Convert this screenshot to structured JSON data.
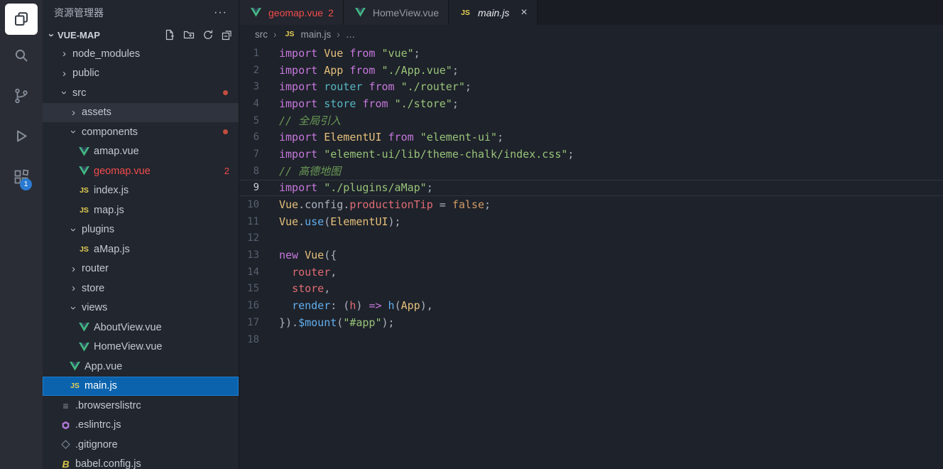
{
  "activity_bar": {
    "items": [
      {
        "name": "explorer",
        "active": true
      },
      {
        "name": "search"
      },
      {
        "name": "source-control"
      },
      {
        "name": "run-and-debug"
      },
      {
        "name": "extensions",
        "badge": "1"
      }
    ]
  },
  "sidebar": {
    "title": "资源管理器",
    "title_more": "···",
    "section": {
      "label": "VUE-MAP",
      "actions": [
        "new-file",
        "new-folder",
        "refresh-explorer",
        "collapse-folders"
      ]
    },
    "tree": [
      {
        "label": "node_modules",
        "depth": 0,
        "arrow": "collapsed"
      },
      {
        "label": "public",
        "depth": 0,
        "arrow": "collapsed"
      },
      {
        "label": "src",
        "depth": 0,
        "arrow": "expanded",
        "dot": true
      },
      {
        "label": "assets",
        "depth": 1,
        "arrow": "collapsed",
        "state": "hover"
      },
      {
        "label": "components",
        "depth": 1,
        "arrow": "expanded",
        "dot": true
      },
      {
        "label": "amap.vue",
        "depth": 2,
        "icon": "vue"
      },
      {
        "label": "geomap.vue",
        "depth": 2,
        "icon": "vue",
        "error": true,
        "badge": "2"
      },
      {
        "label": "index.js",
        "depth": 2,
        "icon": "js"
      },
      {
        "label": "map.js",
        "depth": 2,
        "icon": "js"
      },
      {
        "label": "plugins",
        "depth": 1,
        "arrow": "expanded"
      },
      {
        "label": "aMap.js",
        "depth": 2,
        "icon": "js"
      },
      {
        "label": "router",
        "depth": 1,
        "arrow": "collapsed"
      },
      {
        "label": "store",
        "depth": 1,
        "arrow": "collapsed"
      },
      {
        "label": "views",
        "depth": 1,
        "arrow": "expanded"
      },
      {
        "label": "AboutView.vue",
        "depth": 2,
        "icon": "vue"
      },
      {
        "label": "HomeView.vue",
        "depth": 2,
        "icon": "vue"
      },
      {
        "label": "App.vue",
        "depth": 1,
        "icon": "vue"
      },
      {
        "label": "main.js",
        "depth": 1,
        "icon": "js",
        "state": "selected"
      },
      {
        "label": ".browserslistrc",
        "depth": 0,
        "icon": "browserslist"
      },
      {
        "label": ".eslintrc.js",
        "depth": 0,
        "icon": "eslint"
      },
      {
        "label": ".gitignore",
        "depth": 0,
        "icon": "gitignore"
      },
      {
        "label": "babel.config.js",
        "depth": 0,
        "icon": "babel"
      }
    ]
  },
  "editor": {
    "tabs": [
      {
        "label": "geomap.vue",
        "icon": "vue",
        "badge": "2",
        "active": false,
        "error": true
      },
      {
        "label": "HomeView.vue",
        "icon": "vue",
        "active": false
      },
      {
        "label": "main.js",
        "icon": "js",
        "active": true,
        "italic": true,
        "close": "×"
      }
    ],
    "breadcrumb": {
      "items": [
        {
          "label": "src"
        },
        {
          "label": "main.js",
          "icon": "js"
        },
        {
          "label": "…"
        }
      ]
    },
    "code_lines": [
      {
        "n": 1,
        "t": [
          [
            "import",
            "kw"
          ],
          [
            " "
          ],
          [
            "Vue",
            "cls"
          ],
          [
            " "
          ],
          [
            "from",
            "kw"
          ],
          [
            " "
          ],
          [
            "\"vue\"",
            "str"
          ],
          [
            ";"
          ]
        ]
      },
      {
        "n": 2,
        "t": [
          [
            "import",
            "kw"
          ],
          [
            " "
          ],
          [
            "App",
            "cls"
          ],
          [
            " "
          ],
          [
            "from",
            "kw"
          ],
          [
            " "
          ],
          [
            "\"./App.vue\"",
            "str"
          ],
          [
            ";"
          ]
        ]
      },
      {
        "n": 3,
        "t": [
          [
            "import",
            "kw"
          ],
          [
            " "
          ],
          [
            "router",
            "ent"
          ],
          [
            " "
          ],
          [
            "from",
            "kw"
          ],
          [
            " "
          ],
          [
            "\"./router\"",
            "str"
          ],
          [
            ";"
          ]
        ]
      },
      {
        "n": 4,
        "t": [
          [
            "import",
            "kw"
          ],
          [
            " "
          ],
          [
            "store",
            "ent"
          ],
          [
            " "
          ],
          [
            "from",
            "kw"
          ],
          [
            " "
          ],
          [
            "\"./store\"",
            "str"
          ],
          [
            ";"
          ]
        ]
      },
      {
        "n": 5,
        "t": [
          [
            "// 全局引入",
            "com"
          ]
        ]
      },
      {
        "n": 6,
        "t": [
          [
            "import",
            "kw"
          ],
          [
            " "
          ],
          [
            "ElementUI",
            "cls"
          ],
          [
            " "
          ],
          [
            "from",
            "kw"
          ],
          [
            " "
          ],
          [
            "\"element-ui\"",
            "str"
          ],
          [
            ";"
          ]
        ]
      },
      {
        "n": 7,
        "t": [
          [
            "import",
            "kw"
          ],
          [
            " "
          ],
          [
            "\"element-ui/lib/theme-chalk/index.css\"",
            "str"
          ],
          [
            ";"
          ]
        ]
      },
      {
        "n": 8,
        "t": [
          [
            "// 高德地图",
            "com"
          ]
        ]
      },
      {
        "n": 9,
        "cur": true,
        "t": [
          [
            "import",
            "kw"
          ],
          [
            " "
          ],
          [
            "\"./plugins/aMap\"",
            "str"
          ],
          [
            ";"
          ]
        ]
      },
      {
        "n": 10,
        "t": [
          [
            "Vue",
            "cls"
          ],
          [
            "."
          ],
          [
            "config"
          ],
          [
            "."
          ],
          [
            "productionTip",
            "var"
          ],
          [
            " = "
          ],
          [
            "false",
            "num"
          ],
          [
            ";"
          ]
        ]
      },
      {
        "n": 11,
        "t": [
          [
            "Vue",
            "cls"
          ],
          [
            "."
          ],
          [
            "use",
            "fn"
          ],
          [
            "("
          ],
          [
            "ElementUI",
            "cls"
          ],
          [
            ");"
          ]
        ]
      },
      {
        "n": 12,
        "t": []
      },
      {
        "n": 13,
        "t": [
          [
            "new",
            "kw"
          ],
          [
            " "
          ],
          [
            "Vue",
            "cls"
          ],
          [
            "({"
          ]
        ]
      },
      {
        "n": 14,
        "t": [
          [
            "  "
          ],
          [
            "router",
            "var"
          ],
          [
            ","
          ]
        ]
      },
      {
        "n": 15,
        "t": [
          [
            "  "
          ],
          [
            "store",
            "var"
          ],
          [
            ","
          ]
        ]
      },
      {
        "n": 16,
        "t": [
          [
            "  "
          ],
          [
            "render",
            "fn"
          ],
          [
            ": ("
          ],
          [
            "h",
            "var"
          ],
          [
            ") "
          ],
          [
            "=>",
            "kw"
          ],
          [
            " "
          ],
          [
            "h",
            "fn"
          ],
          [
            "("
          ],
          [
            "App",
            "cls"
          ],
          [
            "),"
          ]
        ]
      },
      {
        "n": 17,
        "t": [
          [
            "})."
          ],
          [
            "$mount",
            "fn"
          ],
          [
            "("
          ],
          [
            "\"#app\"",
            "str"
          ],
          [
            ");"
          ]
        ]
      },
      {
        "n": 18,
        "t": []
      }
    ]
  },
  "colors": {
    "selection_blue": "#0b63ae",
    "error_red": "#f14c4c",
    "vue_green": "#41b883",
    "js_yellow": "#e6cf54",
    "badge_blue": "#2a7ad1",
    "modified_dot": "#c24d3f"
  }
}
